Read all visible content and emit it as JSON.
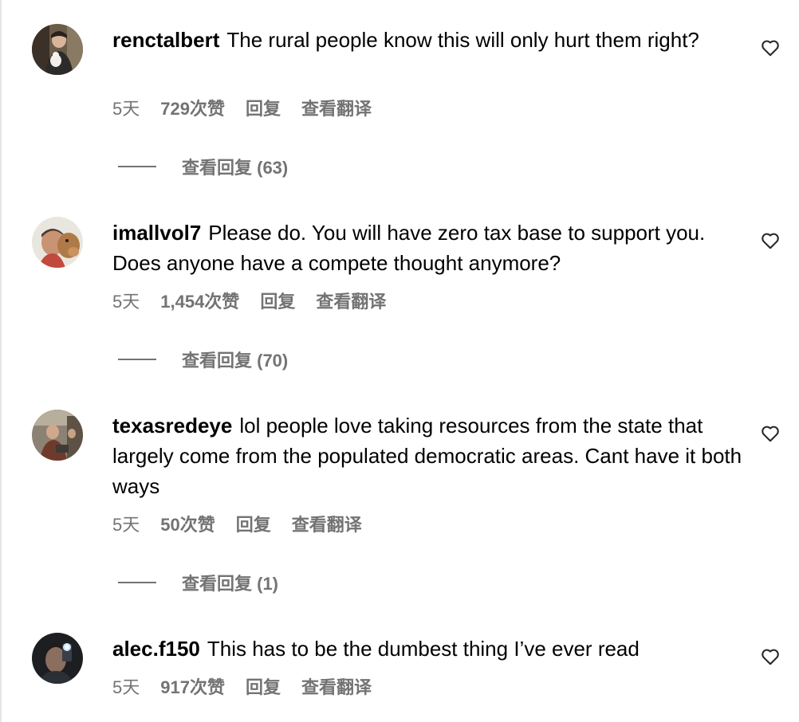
{
  "comments": [
    {
      "username": "renctalbert",
      "text": "The rural people know this will only hurt them right?",
      "time": "5天",
      "likes": "729次赞",
      "reply": "回复",
      "translate": "查看翻译",
      "view_replies": "查看回复 (63)",
      "avatar_icon": "user-avatar-photo",
      "like_icon": "heart-outline-icon"
    },
    {
      "username": "imallvol7",
      "text": "Please do. You will have zero tax base to support you. Does anyone have a compete thought anymore?",
      "time": "5天",
      "likes": "1,454次赞",
      "reply": "回复",
      "translate": "查看翻译",
      "view_replies": "查看回复 (70)",
      "avatar_icon": "user-avatar-photo",
      "like_icon": "heart-outline-icon"
    },
    {
      "username": "texasredeye",
      "text": "lol people love taking resources from the state that largely come from the populated democratic areas. Cant have it both ways",
      "time": "5天",
      "likes": "50次赞",
      "reply": "回复",
      "translate": "查看翻译",
      "view_replies": "查看回复 (1)",
      "avatar_icon": "user-avatar-photo",
      "like_icon": "heart-outline-icon"
    },
    {
      "username": "alec.f150",
      "text": "This has to be the dumbest thing I’ve ever read",
      "time": "5天",
      "likes": "917次赞",
      "reply": "回复",
      "translate": "查看翻译",
      "avatar_icon": "user-avatar-photo",
      "like_icon": "heart-outline-icon"
    }
  ],
  "colors": {
    "text": "#000000",
    "secondary": "#737373",
    "border": "#e6e6e6"
  }
}
